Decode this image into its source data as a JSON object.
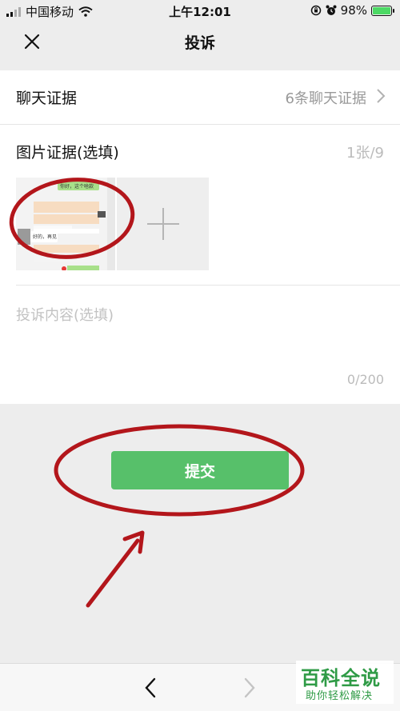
{
  "status_bar": {
    "carrier": "中国移动",
    "time": "上午12:01",
    "battery_pct": "98%",
    "battery_level": 0.98,
    "icons": [
      "signal-icon",
      "wifi-icon",
      "lock-rotation-icon",
      "alarm-icon",
      "battery-icon"
    ]
  },
  "nav": {
    "title": "投诉",
    "close_icon": "close-icon"
  },
  "form": {
    "chat_evidence": {
      "label": "聊天证据",
      "value": "6条聊天证据"
    },
    "image_evidence": {
      "label": "图片证据(选填)",
      "count": "1张/9"
    },
    "complaint": {
      "placeholder": "投诉内容(选填)",
      "counter": "0/200"
    }
  },
  "thumbnail": {
    "bubbles": [
      "你好，这个啥款",
      "好的，再见"
    ]
  },
  "submit": {
    "label": "提交"
  },
  "annotation": {
    "color": "#b3161b"
  },
  "colors": {
    "accent": "#57c06a",
    "background": "#ededed"
  },
  "watermark": {
    "title": "百科全说",
    "subtitle": "助你轻松解决"
  }
}
